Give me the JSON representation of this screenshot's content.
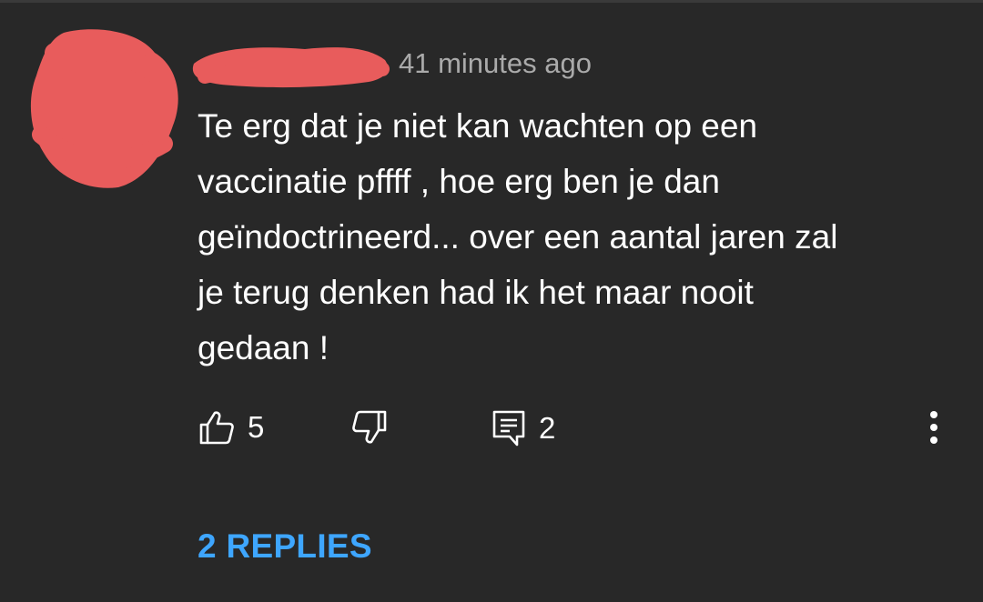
{
  "comment": {
    "timestamp": "41 minutes ago",
    "text_lines": [
      "Te erg dat je niet kan wachten op een",
      "vaccinatie pffff , hoe erg ben je dan",
      "geïndoctrineerd... over een aantal jaren zal",
      "je terug denken had ik het maar nooit",
      "gedaan !"
    ],
    "like_count": "5",
    "reply_count": "2",
    "replies_label": "2 REPLIES"
  },
  "icons": {
    "like": "thumbs-up-icon",
    "dislike": "thumbs-down-icon",
    "reply": "comment-icon",
    "more": "more-vert-icon"
  },
  "colors": {
    "background": "#282828",
    "text": "#ffffff",
    "secondary_text": "#aaaaaa",
    "link": "#3ea6ff",
    "redaction": "#e85c5c"
  }
}
